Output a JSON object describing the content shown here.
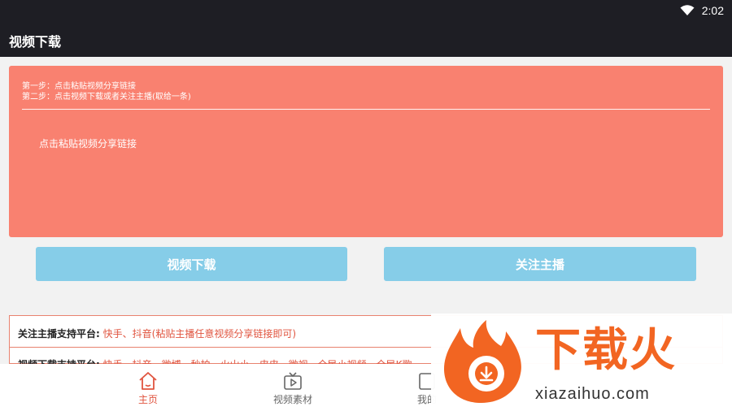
{
  "status": {
    "time": "2:02"
  },
  "appbar": {
    "title": "视频下载"
  },
  "card": {
    "step1": "第一步：点击粘贴视频分享链接",
    "step2": "第二步：点击视频下载或者关注主播(取给一条)",
    "paste_hint": "点击粘贴视频分享链接"
  },
  "buttons": {
    "download": "视频下载",
    "follow": "关注主播"
  },
  "info": {
    "row1_label": "关注主播支持平台:",
    "row1_value": "快手、抖音(粘贴主播任意视频分享链接即可)",
    "row2_label": "视频下载支持平台:",
    "row2_value": "快手、抖音、微博、秒拍、火山小、皮皮、微视、全民小视频、全民K歌"
  },
  "tabs": [
    {
      "label": "主页",
      "icon": "home-icon",
      "active": true
    },
    {
      "label": "视频素材",
      "icon": "video-icon",
      "active": false
    },
    {
      "label": "我的",
      "icon": "profile-icon",
      "active": false
    }
  ],
  "watermark": {
    "brand": "下载火",
    "url": "xiazaihuo.com"
  },
  "colors": {
    "bar": "#1e1e24",
    "card": "#f98170",
    "button": "#86cde8",
    "accent": "#e0543f",
    "brand": "#f26522"
  }
}
